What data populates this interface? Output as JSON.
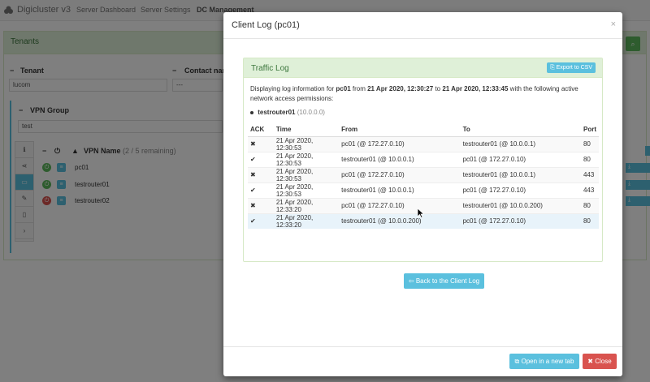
{
  "app": {
    "brand": "Digicluster v3",
    "nav": [
      "Server Dashboard",
      "Server Settings",
      "DC Management"
    ]
  },
  "background": {
    "panel_title": "Tenants",
    "tenant_label": "Tenant",
    "tenant_value": "lucom",
    "contact_label": "Contact name",
    "contact_value": "---",
    "vpn_group_label": "VPN Group",
    "vpn_group_value": "test",
    "vpn_name_label": "VPN Name",
    "vpn_remaining": "(2 / 5 remaining)",
    "vpn_rows": [
      "pc01",
      "testrouter01",
      "testrouter02"
    ]
  },
  "modal": {
    "title": "Client Log (pc01)",
    "close_glyph": "×",
    "traffic_title": "Traffic Log",
    "export_label": "Export to CSV",
    "desc_prefix": "Displaying log information for",
    "desc_client": "pc01",
    "desc_from": "from",
    "desc_start": "21 Apr 2020, 12:30:27",
    "desc_to": "to",
    "desc_end": "21 Apr 2020, 12:33:45",
    "desc_suffix": "with the following active network access permissions:",
    "permission_name": "testrouter01",
    "permission_ip": "(10.0.0.0)",
    "columns": [
      "ACK",
      "Time",
      "From",
      "To",
      "Port"
    ],
    "rows": [
      {
        "ack": "✖",
        "time": "21 Apr 2020, 12:30:53",
        "from": "pc01 (@ 172.27.0.10)",
        "to": "testrouter01 (@ 10.0.0.1)",
        "port": "80"
      },
      {
        "ack": "✔",
        "time": "21 Apr 2020, 12:30:53",
        "from": "testrouter01 (@ 10.0.0.1)",
        "to": "pc01 (@ 172.27.0.10)",
        "port": "80"
      },
      {
        "ack": "✖",
        "time": "21 Apr 2020, 12:30:53",
        "from": "pc01 (@ 172.27.0.10)",
        "to": "testrouter01 (@ 10.0.0.1)",
        "port": "443"
      },
      {
        "ack": "✔",
        "time": "21 Apr 2020, 12:30:53",
        "from": "testrouter01 (@ 10.0.0.1)",
        "to": "pc01 (@ 172.27.0.10)",
        "port": "443"
      },
      {
        "ack": "✖",
        "time": "21 Apr 2020, 12:33:20",
        "from": "pc01 (@ 172.27.0.10)",
        "to": "testrouter01 (@ 10.0.0.200)",
        "port": "80"
      },
      {
        "ack": "✔",
        "time": "21 Apr 2020, 12:33:20",
        "from": "testrouter01 (@ 10.0.0.200)",
        "to": "pc01 (@ 172.27.0.10)",
        "port": "80"
      }
    ],
    "back_label": "Back to the Client Log",
    "open_label": "Open in a new tab",
    "close_label": "Close"
  },
  "colors": {
    "info": "#5bc0de",
    "danger": "#d9534f",
    "success": "#5cb85c",
    "panel_header": "#dff0d8"
  }
}
